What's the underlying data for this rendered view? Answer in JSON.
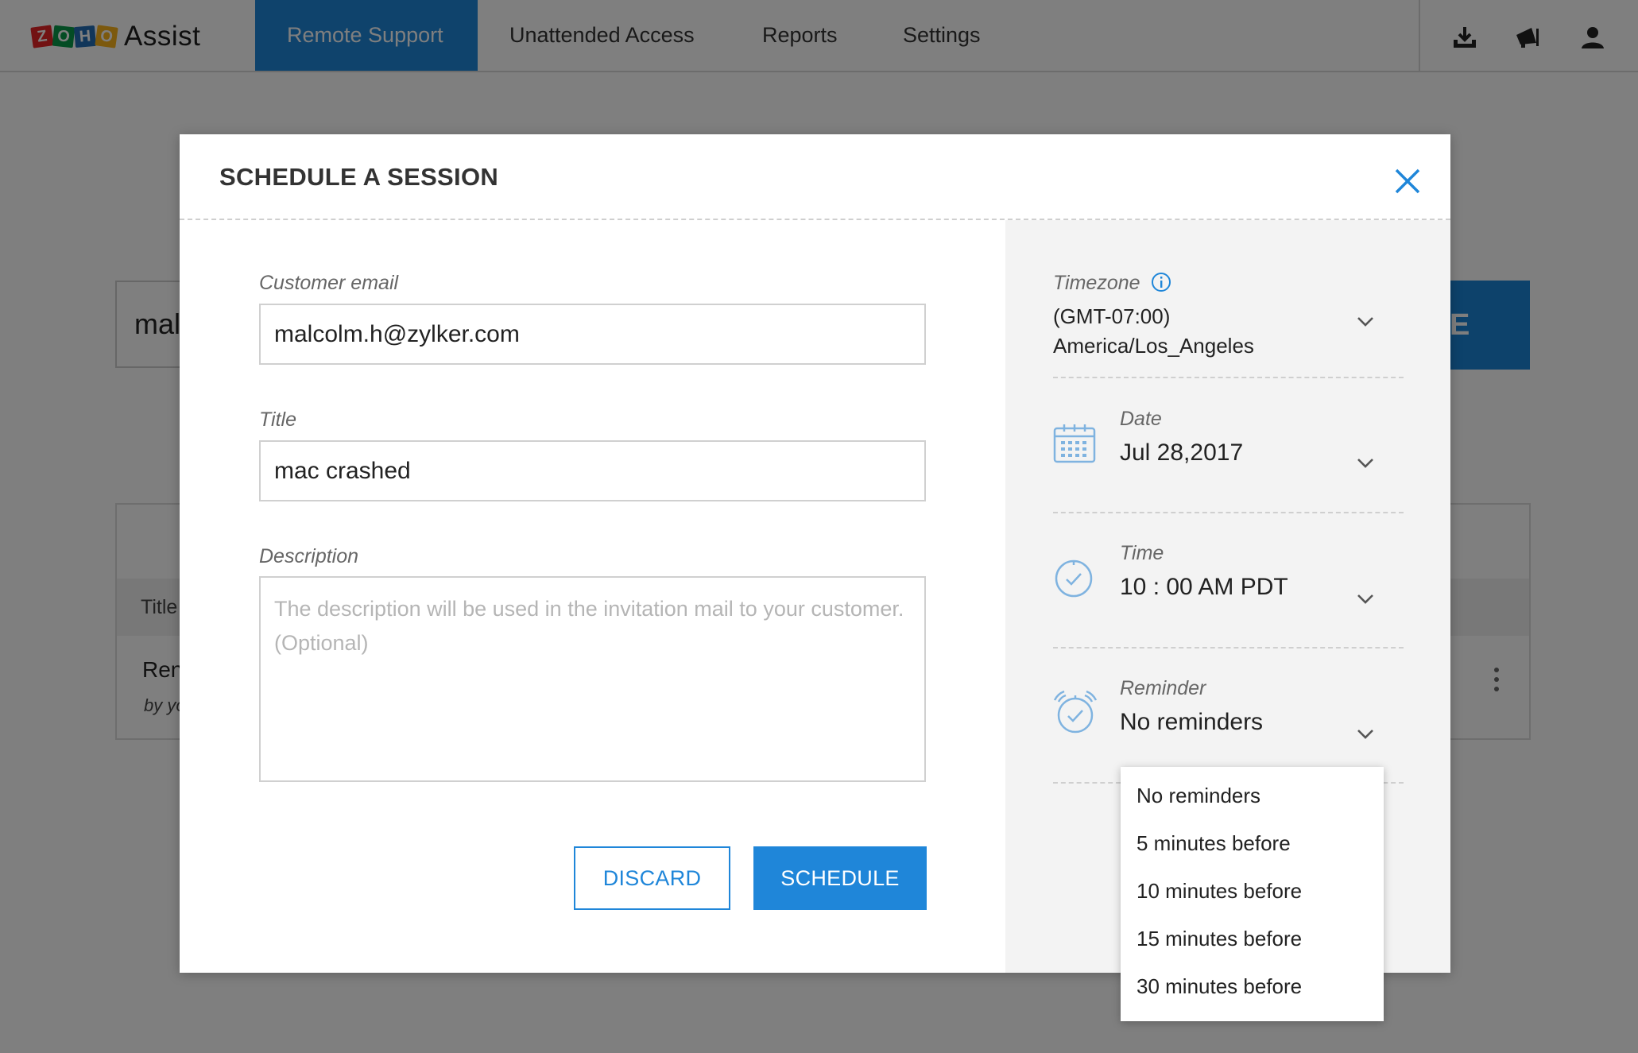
{
  "app": {
    "logo_letters": [
      "Z",
      "O",
      "H",
      "O"
    ],
    "brand": "Assist"
  },
  "nav": {
    "tabs": [
      {
        "label": "Remote Support",
        "active": true
      },
      {
        "label": "Unattended Access",
        "active": false
      },
      {
        "label": "Reports",
        "active": false
      },
      {
        "label": "Settings",
        "active": false
      }
    ],
    "icons": [
      "download-icon",
      "announcement-icon",
      "user-icon"
    ]
  },
  "background": {
    "search_value": "mal",
    "button_partial": "E",
    "table_header": "Title",
    "row_title": "Ren",
    "row_by": "by yo"
  },
  "modal": {
    "title": "SCHEDULE A SESSION",
    "customer_email": {
      "label": "Customer email",
      "value": "malcolm.h@zylker.com"
    },
    "title_field": {
      "label": "Title",
      "value": "mac crashed"
    },
    "description": {
      "label": "Description",
      "placeholder": "The description will be used in the invitation mail to your customer. (Optional)"
    },
    "discard_label": "DISCARD",
    "schedule_label": "SCHEDULE"
  },
  "settings_panel": {
    "timezone": {
      "label": "Timezone",
      "offset": "(GMT-07:00)",
      "zone": "America/Los_Angeles"
    },
    "date": {
      "label": "Date",
      "value": "Jul 28,2017"
    },
    "time": {
      "label": "Time",
      "value": "10 : 00 AM PDT"
    },
    "reminder": {
      "label": "Reminder",
      "value": "No reminders"
    }
  },
  "reminder_options": [
    "No reminders",
    "5 minutes before",
    "10 minutes before",
    "15 minutes before",
    "30 minutes before"
  ],
  "colors": {
    "accent": "#1f86d9",
    "overlay": "rgba(0,0,0,0.5)",
    "panel_bg": "#f3f3f3"
  }
}
